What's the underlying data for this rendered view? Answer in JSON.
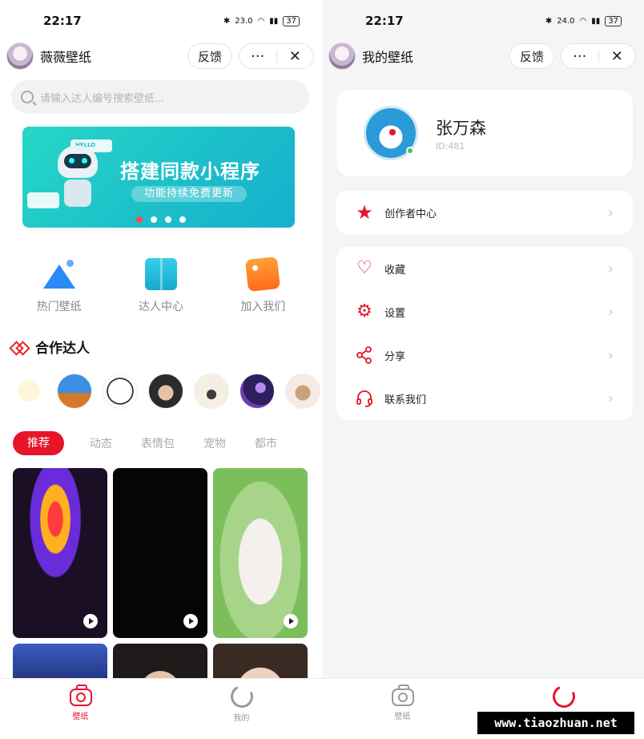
{
  "left_screen": {
    "status": {
      "time": "22:17",
      "net_speed": "23.0",
      "battery": "37"
    },
    "nav": {
      "title": "薇薇壁纸",
      "feedback": "反馈",
      "more": "···",
      "close": "✕"
    },
    "search": {
      "placeholder": "请输入达人编号搜索壁纸..."
    },
    "banner": {
      "title": "搭建同款小程序",
      "subtitle": "功能持续免费更新",
      "tag": "HELLO"
    },
    "quick_menu": [
      {
        "label": "热门壁纸",
        "icon": "mountain-icon"
      },
      {
        "label": "达人中心",
        "icon": "box-icon"
      },
      {
        "label": "加入我们",
        "icon": "tag-icon"
      }
    ],
    "partners_title": "合作达人",
    "categories": [
      "推荐",
      "动态",
      "表情包",
      "宠物",
      "都市"
    ],
    "tabbar": [
      {
        "label": "壁纸",
        "icon": "camera-icon",
        "active": true
      },
      {
        "label": "我的",
        "icon": "ring-icon",
        "active": false
      }
    ]
  },
  "right_screen": {
    "status": {
      "time": "22:17",
      "net_speed": "24.0",
      "battery": "37"
    },
    "nav": {
      "title": "我的壁纸",
      "feedback": "反馈",
      "more": "···",
      "close": "✕"
    },
    "profile": {
      "name": "张万森",
      "id": "ID:481"
    },
    "creator_menu": [
      {
        "label": "创作者中心",
        "icon": "star-icon"
      }
    ],
    "menu": [
      {
        "label": "收藏",
        "icon": "heart-icon"
      },
      {
        "label": "设置",
        "icon": "gear-icon"
      },
      {
        "label": "分享",
        "icon": "share-icon"
      },
      {
        "label": "联系我们",
        "icon": "headset-icon"
      }
    ],
    "tabbar": [
      {
        "label": "壁纸",
        "icon": "camera-icon",
        "active": false
      },
      {
        "label": "我的",
        "icon": "ring-icon",
        "active": true
      }
    ]
  },
  "watermark": "www.tiaozhuan.net",
  "colors": {
    "accent": "#e5162a",
    "banner": "#1cc0c9",
    "search_bg": "#f2f2f4"
  }
}
